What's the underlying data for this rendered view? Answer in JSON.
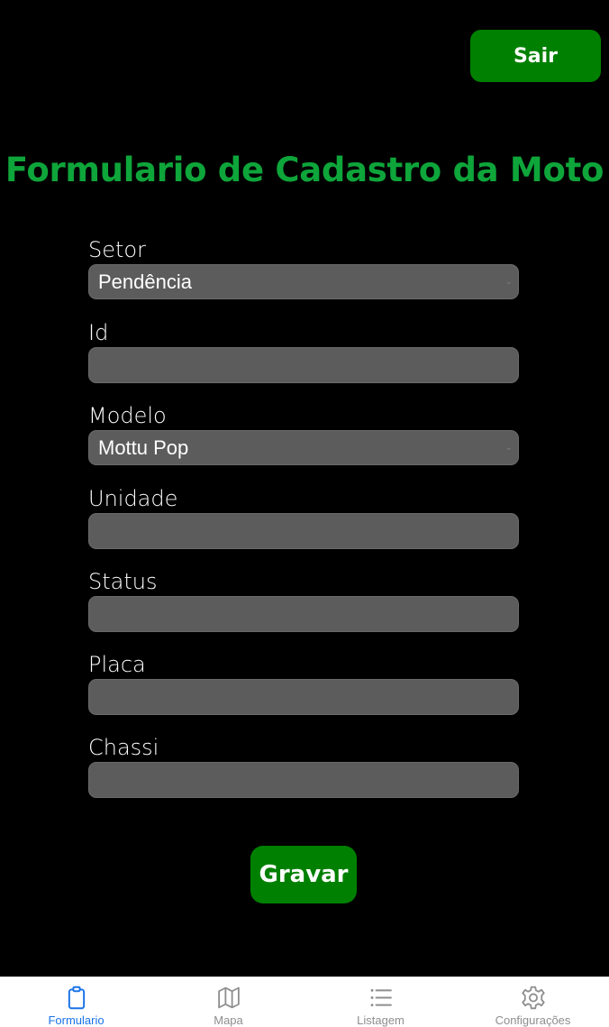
{
  "header": {
    "logout_label": "Sair"
  },
  "form": {
    "title": "Formulario de Cadastro da Moto",
    "fields": [
      {
        "label": "Setor",
        "type": "select",
        "value": "Pendência"
      },
      {
        "label": "Id",
        "type": "text",
        "value": ""
      },
      {
        "label": "Modelo",
        "type": "select",
        "value": "Mottu Pop"
      },
      {
        "label": "Unidade",
        "type": "text",
        "value": ""
      },
      {
        "label": "Status",
        "type": "text",
        "value": ""
      },
      {
        "label": "Placa",
        "type": "text",
        "value": ""
      },
      {
        "label": "Chassi",
        "type": "text",
        "value": ""
      }
    ],
    "submit_label": "Gravar"
  },
  "tabbar": {
    "tabs": [
      {
        "label": "Formulario",
        "icon": "clipboard-icon",
        "active": true
      },
      {
        "label": "Mapa",
        "icon": "map-icon",
        "active": false
      },
      {
        "label": "Listagem",
        "icon": "list-icon",
        "active": false
      },
      {
        "label": "Configurações",
        "icon": "gear-icon",
        "active": false
      }
    ]
  },
  "colors": {
    "background": "#000000",
    "title": "#0ea53a",
    "button": "#008000",
    "input_bg": "#5c5c5c",
    "tab_active": "#1a73e8",
    "tab_inactive": "#8e8e8f"
  }
}
